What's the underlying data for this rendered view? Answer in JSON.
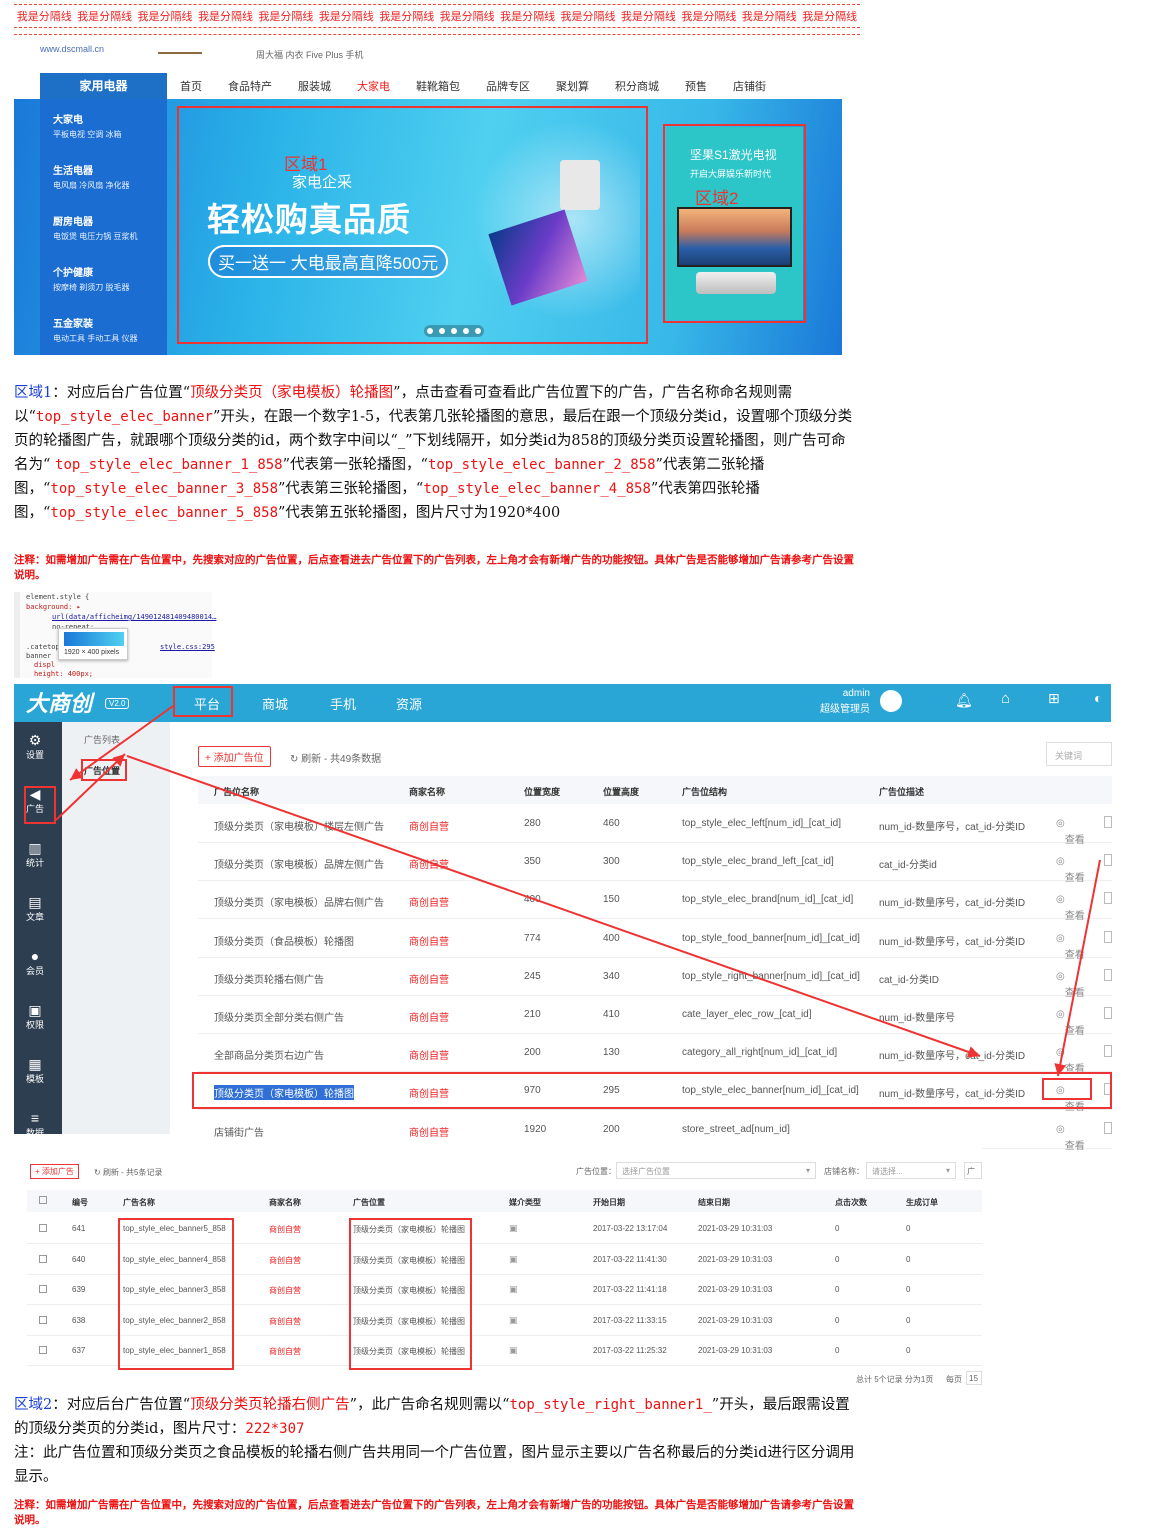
{
  "separator": {
    "text": "我是分隔线",
    "count": 14
  },
  "mall": {
    "url": "www.dscmall.cn",
    "tiny_links": "周大福  内衣  Five Plus  手机",
    "category_tab": "家用电器",
    "nav": [
      "首页",
      "食品特产",
      "服装城",
      "大家电",
      "鞋靴箱包",
      "品牌专区",
      "聚划算",
      "积分商城",
      "预售",
      "店铺街"
    ],
    "nav_active": 3,
    "categories": [
      {
        "title": "大家电",
        "items": "平板电视  空调  冰箱"
      },
      {
        "title": "生活电器",
        "items": "电风扇  冷风扇  净化器"
      },
      {
        "title": "厨房电器",
        "items": "电饭煲  电压力锅  豆浆机"
      },
      {
        "title": "个护健康",
        "items": "按摩椅  剃须刀  脱毛器"
      },
      {
        "title": "五金家装",
        "items": "电动工具  手动工具  仪器"
      }
    ],
    "zone1_label": "区域1",
    "banner_sub": "家电企采",
    "banner_main": "轻松购真品质",
    "banner_pill": "买一送一 大电最高直降500元",
    "zone2_label": "区域2",
    "zone2_title": "坚果S1激光电视",
    "zone2_sub": "开启大屏娱乐新时代"
  },
  "para1": {
    "lead": "区域1",
    "t1": "：对应后台广告位置“",
    "pos": "顶级分类页（家电模板）轮播图",
    "t2": "”，点击查看可查看此广告位置下的广告，广告名称命名规则需以“",
    "prefix": "top_style_elec_banner",
    "t3": "”开头，在跟一个数字1-5，代表第几张轮播图的意思，最后在跟一个顶级分类id，设置哪个顶级分类页的轮播图广告，就跟哪个顶级分类的id，两个数字中间以“_”下划线隔开，如分类id为858的顶级分类页设置轮播图，则广告可命名为“ ",
    "n1": "top_style_elec_banner_1_858",
    "t4": "”代表第一张轮播图，“",
    "n2": "top_style_elec_banner_2_858",
    "t5": "”代表第二张轮播图，“",
    "n3": "top_style_elec_banner_3_858",
    "t6": "”代表第三张轮播图，“",
    "n4": "top_style_elec_banner_4_858",
    "t7": "”代表第四张轮播图，“",
    "n5": "top_style_elec_banner_5_858",
    "t8": "”代表第五张轮播图，图片尺寸为1920*400"
  },
  "note": "注释：如需增加广告需在广告位置中，先搜索对应的广告位置，后点查看进去广告位置下的广告列表，左上角才会有新增广告的功能按钮。具体广告是否能够增加广告请参考广告设置说明。",
  "devtools": {
    "l1": "element.style {",
    "l2": "background: ▸",
    "l3": "url(data/afficheimg/149012481409480014…",
    "l4": "no-repeat;",
    "l5": ".catetop",
    "l6": "banner",
    "l7": "displ",
    "l8": "height: 400px;",
    "link": "style.css:295",
    "tip": "1920 × 400 pixels"
  },
  "admin": {
    "logo": "大商创",
    "version": "V2.0",
    "topnav": [
      "平台",
      "商城",
      "手机",
      "资源"
    ],
    "user": "admin",
    "role": "超级管理员",
    "left": [
      {
        "icon": "⚙",
        "label": "设置"
      },
      {
        "icon": "◀",
        "label": "广告"
      },
      {
        "icon": "▥",
        "label": "统计"
      },
      {
        "icon": "▤",
        "label": "文章"
      },
      {
        "icon": "●",
        "label": "会员"
      },
      {
        "icon": "▣",
        "label": "权限"
      },
      {
        "icon": "▦",
        "label": "模板"
      },
      {
        "icon": "≡",
        "label": "数据"
      }
    ],
    "sub": [
      "广告列表",
      "广告位置"
    ],
    "add_btn": "添加广告位",
    "refresh": "刷新 - 共49条数据",
    "search_ph": "关键词",
    "headers": [
      "广告位名称",
      "商家名称",
      "位置宽度",
      "位置高度",
      "广告位结构",
      "广告位描述"
    ],
    "rows": [
      [
        "顶级分类页（家电模板）楼层左侧广告",
        "商创自营",
        "280",
        "460",
        "top_style_elec_left[num_id]_[cat_id]",
        "num_id-数量序号，cat_id-分类ID"
      ],
      [
        "顶级分类页（家电模板）品牌左侧广告",
        "商创自营",
        "350",
        "300",
        "top_style_elec_brand_left_[cat_id]",
        "cat_id-分类id"
      ],
      [
        "顶级分类页（家电模板）品牌右侧广告",
        "商创自营",
        "400",
        "150",
        "top_style_elec_brand[num_id]_[cat_id]",
        "num_id-数量序号，cat_id-分类ID"
      ],
      [
        "顶级分类页（食品模板）轮播图",
        "商创自营",
        "774",
        "400",
        "top_style_food_banner[num_id]_[cat_id]",
        "num_id-数量序号，cat_id-分类ID"
      ],
      [
        "顶级分类页轮播右侧广告",
        "商创自营",
        "245",
        "340",
        "top_style_right_banner[num_id]_[cat_id]",
        "cat_id-分类ID"
      ],
      [
        "顶级分类页全部分类右侧广告",
        "商创自营",
        "210",
        "410",
        "cate_layer_elec_row_[cat_id]",
        "num_id-数量序号"
      ],
      [
        "全部商品分类页右边广告",
        "商创自营",
        "200",
        "130",
        "category_all_right[num_id]_[cat_id]",
        "num_id-数量序号，cat_id-分类ID"
      ],
      [
        "顶级分类页（家电模板）轮播图",
        "商创自营",
        "970",
        "295",
        "top_style_elec_banner[num_id]_[cat_id]",
        "num_id-数量序号，cat_id-分类ID"
      ],
      [
        "店铺街广告",
        "商创自营",
        "1920",
        "200",
        "store_street_ad[num_id]",
        ""
      ]
    ],
    "view": "查看"
  },
  "adlist": {
    "add_btn": "添加广告",
    "refresh": "刷新 - 共5条记录",
    "pos_label": "广告位置：",
    "pos_ph": "选择广告位置",
    "shop_label": "店铺名称：",
    "shop_ph": "请选择...",
    "more": "广",
    "headers": [
      "编号",
      "广告名称",
      "商家名称",
      "广告位置",
      "媒介类型",
      "开始日期",
      "结束日期",
      "点击次数",
      "生成订单"
    ],
    "rows": [
      [
        "641",
        "top_style_elec_banner5_858",
        "商创自营",
        "顶级分类页（家电模板）轮播图",
        "2017-03-22 13:17:04",
        "2021-03-29 10:31:03",
        "0",
        "0"
      ],
      [
        "640",
        "top_style_elec_banner4_858",
        "商创自营",
        "顶级分类页（家电模板）轮播图",
        "2017-03-22 11:41:30",
        "2021-03-29 10:31:03",
        "0",
        "0"
      ],
      [
        "639",
        "top_style_elec_banner3_858",
        "商创自营",
        "顶级分类页（家电模板）轮播图",
        "2017-03-22 11:41:18",
        "2021-03-29 10:31:03",
        "0",
        "0"
      ],
      [
        "638",
        "top_style_elec_banner2_858",
        "商创自营",
        "顶级分类页（家电模板）轮播图",
        "2017-03-22 11:33:15",
        "2021-03-29 10:31:03",
        "0",
        "0"
      ],
      [
        "637",
        "top_style_elec_banner1_858",
        "商创自营",
        "顶级分类页（家电模板）轮播图",
        "2017-03-22 11:25:32",
        "2021-03-29 10:31:03",
        "0",
        "0"
      ]
    ],
    "footer": "总计 5个记录 分为1页",
    "perpage": "每页",
    "perpage_val": "15"
  },
  "para2": {
    "lead": "区域2",
    "t1": "：对应后台广告位置“",
    "pos": "顶级分类页轮播右侧广告",
    "t2": "”，此广告命名规则需以“",
    "prefix": "top_style_right_banner1_",
    "t3": "”开头，最后跟需设置的顶级分类页的分类id，图片尺寸：",
    "size": "222*307",
    "line2": "注：此广告位置和顶级分类页之食品模板的轮播右侧广告共用同一个广告位置，图片显示主要以广告名称最后的分类id进行区分调用显示。"
  },
  "colors": {
    "accent_red": "#e11",
    "admin_blue": "#29a6d6",
    "sidebar": "#2c3e50"
  }
}
